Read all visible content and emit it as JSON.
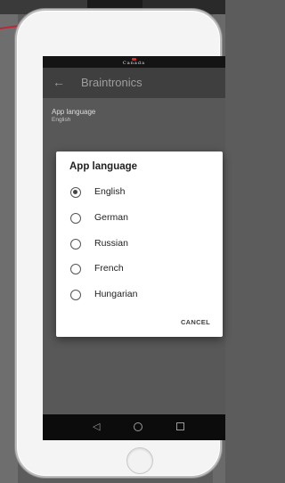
{
  "status_bar": {
    "logo_text": "Canada"
  },
  "app_bar": {
    "back_icon": "arrow-back-icon",
    "title": "Braintronics"
  },
  "preference": {
    "title": "App language",
    "summary": "English"
  },
  "dialog": {
    "title": "App language",
    "options": [
      {
        "label": "English",
        "selected": true
      },
      {
        "label": "German",
        "selected": false
      },
      {
        "label": "Russian",
        "selected": false
      },
      {
        "label": "French",
        "selected": false
      },
      {
        "label": "Hungarian",
        "selected": false
      }
    ],
    "cancel_label": "CANCEL"
  },
  "nav_bar": {
    "back_icon": "triangle-back-icon",
    "home_icon": "circle-home-icon",
    "recent_icon": "square-recents-icon"
  },
  "colors": {
    "accent": "#444444",
    "app_bar": "#3f3f3f",
    "dialog_bg": "#ffffff"
  }
}
